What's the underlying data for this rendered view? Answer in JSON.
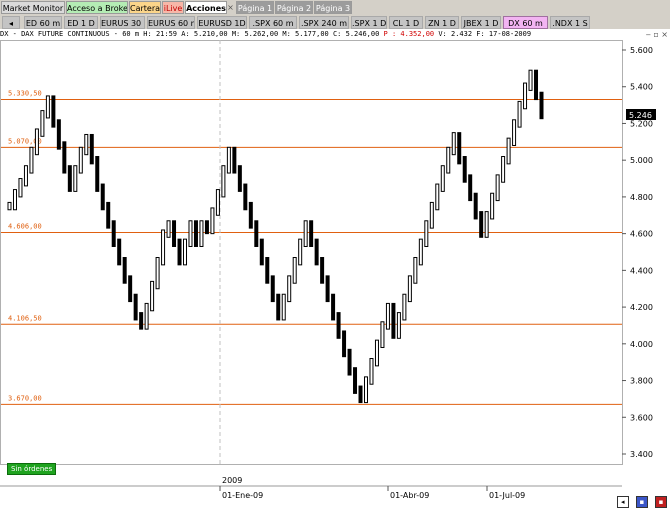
{
  "tabs_top": [
    "Market Monitor",
    "Acceso a Broker",
    "Cartera",
    "iLive",
    "Acciones",
    "Página 1",
    "Página 2",
    "Página 3"
  ],
  "tabs_symbols": [
    "ED 60 m",
    "ED 1 D",
    "EURUS 30 m",
    "EURUS 60 m",
    "EURUSD 1D",
    ".SPX 60 m",
    ".SPX 240 m",
    ".SPX 1 D",
    "CL 1 D",
    "ZN 1 D",
    "JBEX 1 D",
    "DX 60 m",
    ".NDX 1 S"
  ],
  "selected_symbol_tab": "DX 60 m",
  "info": {
    "title": "DX - DAX FUTURE CONTINUOUS -  60 m",
    "hour": "H: 21:59",
    "open": "A: 5.210,00",
    "high": "M: 5.262,00",
    "low": "M: 5.177,00",
    "close": "C: 5.246,00",
    "change": "P : 4.352,00",
    "volume": "V: 2.432",
    "date": "F: 17-08-2009"
  },
  "status_button": "Sin órdenes",
  "last_price_label": "5.246",
  "chart_data": {
    "type": "point-and-figure",
    "ylim": [
      3400,
      5600
    ],
    "y_ticks": [
      "5.600",
      "5.400",
      "5.200",
      "5.000",
      "4.800",
      "4.600",
      "4.400",
      "4.200",
      "4.000",
      "3.800",
      "3.600",
      "3.400"
    ],
    "horizontal_levels": [
      {
        "label": "5.330,50",
        "value": 5330.5
      },
      {
        "label": "5.070,00",
        "value": 5070
      },
      {
        "label": "4.606,00",
        "value": 4606
      },
      {
        "label": "4.106,50",
        "value": 4106.5
      },
      {
        "label": "3.670,00",
        "value": 3670
      }
    ],
    "x_labels": [
      "01-Ene-09",
      "01-Abr-09",
      "01-Jul-09"
    ],
    "year_label": "2009",
    "series": [
      {
        "values": [
          4750,
          4820,
          4880,
          4950,
          5050,
          5150,
          5250,
          5330,
          5200,
          5080,
          4950,
          4850,
          4950,
          5050,
          5120,
          5000,
          4850,
          4750,
          4650,
          4550,
          4450,
          4350,
          4250,
          4150,
          4100,
          4200,
          4320,
          4450,
          4600,
          4650,
          4550,
          4450,
          4550,
          4650,
          4550,
          4650,
          4620,
          4720,
          4820,
          4950,
          5050,
          4950,
          4850,
          4750,
          4650,
          4550,
          4450,
          4350,
          4250,
          4150,
          4250,
          4350,
          4450,
          4550,
          4650,
          4550,
          4450,
          4350,
          4250,
          4150,
          4050,
          3950,
          3850,
          3750,
          3700,
          3800,
          3900,
          4000,
          4100,
          4200,
          4050,
          4150,
          4250,
          4350,
          4450,
          4550,
          4650,
          4750,
          4850,
          4950,
          5050,
          5130,
          5000,
          4900,
          4800,
          4700,
          4600,
          4700,
          4800,
          4900,
          5000,
          5100,
          5200,
          5300,
          5400,
          5470,
          5350,
          5246
        ]
      }
    ]
  }
}
